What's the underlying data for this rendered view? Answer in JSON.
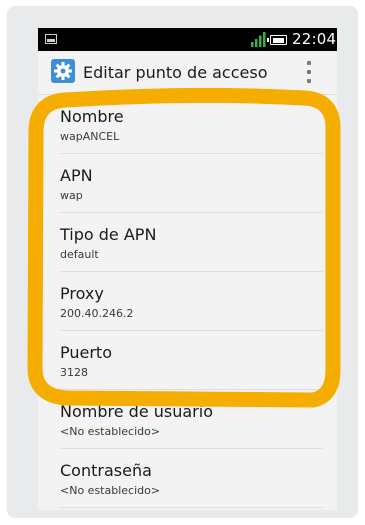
{
  "status_bar": {
    "time": "22:04"
  },
  "action_bar": {
    "title": "Editar punto de acceso",
    "icon": "settings-gear-icon",
    "menu_icon": "overflow-menu-icon"
  },
  "fields": [
    {
      "label": "Nombre",
      "value": "wapANCEL"
    },
    {
      "label": "APN",
      "value": "wap"
    },
    {
      "label": "Tipo de APN",
      "value": "default"
    },
    {
      "label": "Proxy",
      "value": "200.40.246.2"
    },
    {
      "label": "Puerto",
      "value": "3128"
    },
    {
      "label": "Nombre de usuario",
      "value": "<No establecido>"
    },
    {
      "label": "Contraseña",
      "value": "<No establecido>"
    }
  ],
  "colors": {
    "highlight": "#f4ad00",
    "accent": "#3f8fd6",
    "signal": "#35b34a"
  }
}
